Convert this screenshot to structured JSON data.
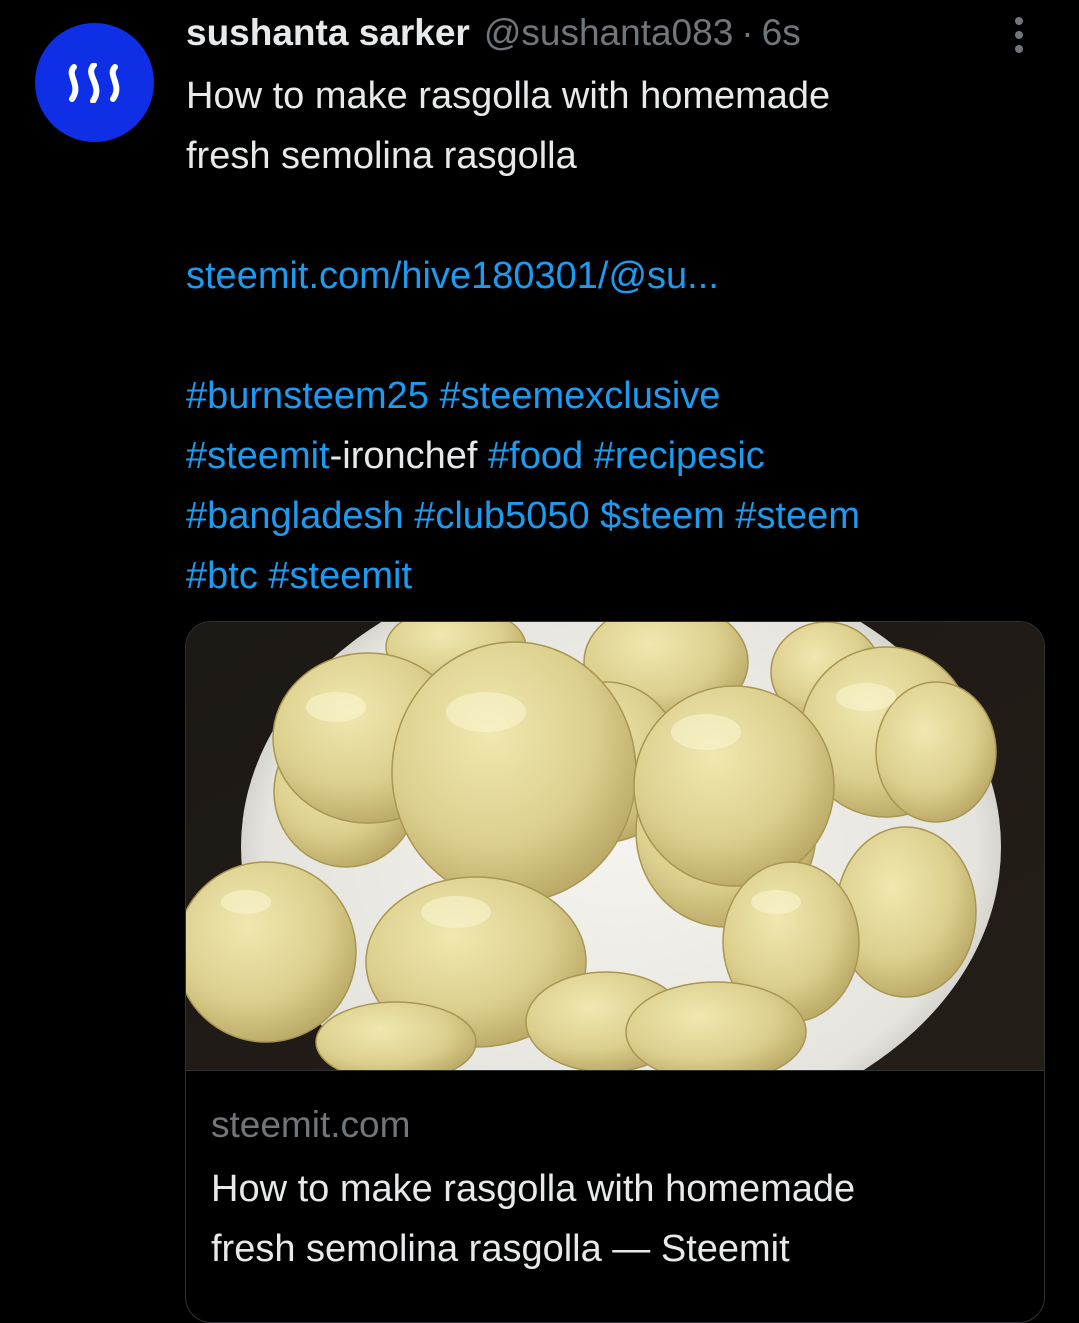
{
  "author": {
    "display_name": "sushanta sarker",
    "handle": "@sushanta083",
    "separator": "·",
    "time": "6s",
    "avatar_icon": "steem-logo-icon",
    "avatar_color": "#0f2fe6"
  },
  "tweet": {
    "title_line1": "How to make rasgolla with homemade",
    "title_line2": "fresh semolina rasgolla",
    "link": "steemit.com/hive180301/@su...",
    "hashtags": {
      "burnsteem25": "#burnsteem25",
      "steemexclusive": "#steemexclusive",
      "steemit_prefix": "#steemit",
      "ironchef_suffix": "-ironchef",
      "food": "#food",
      "recipesic": "#recipesic",
      "bangladesh": "#bangladesh",
      "club5050": "#club5050",
      "cashtag_steem": "$steem",
      "steem": "#steem",
      "btc": "#btc",
      "steemit": "#steemit"
    }
  },
  "card": {
    "image_icon": "rasgolla-photo",
    "domain": "steemit.com",
    "title_line1": "How to make rasgolla with homemade",
    "title_line2": "fresh semolina rasgolla — Steemit"
  },
  "colors": {
    "background": "#000000",
    "text": "#e7e9ea",
    "muted": "#71767b",
    "link": "#1d9bf0",
    "border": "#2f3336"
  },
  "icons": {
    "more": "more-vertical-icon"
  }
}
